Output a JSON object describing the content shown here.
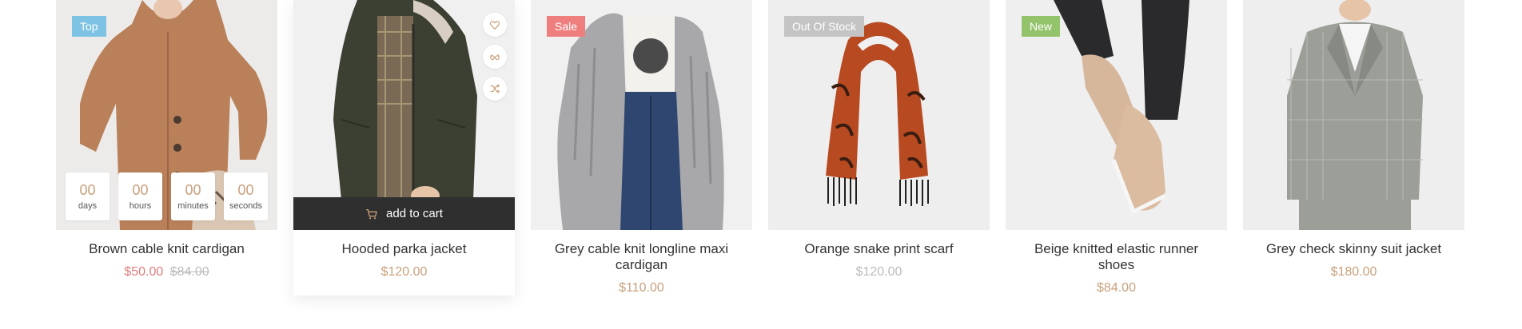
{
  "products": [
    {
      "name": "Brown cable knit cardigan",
      "badge": "Top",
      "badge_color": "#7ec3e4",
      "price": "$50.00",
      "old_price": "$84.00",
      "countdown": [
        {
          "value": "00",
          "label": "days"
        },
        {
          "value": "00",
          "label": "hours"
        },
        {
          "value": "00",
          "label": "minutes"
        },
        {
          "value": "00",
          "label": "seconds"
        }
      ]
    },
    {
      "name": "Hooded parka jacket",
      "price": "$120.00",
      "cart_label": "add to cart",
      "action_icons": [
        "heart-icon",
        "glasses-icon",
        "shuffle-icon"
      ]
    },
    {
      "name": "Grey cable knit longline maxi cardigan",
      "badge": "Sale",
      "badge_color": "#ef7f7f",
      "price": "$110.00"
    },
    {
      "name": "Orange snake print scarf",
      "badge": "Out Of Stock",
      "badge_color": "#c4c4c4",
      "price": "$120.00"
    },
    {
      "name": "Beige knitted elastic runner shoes",
      "badge": "New",
      "badge_color": "#93c36a",
      "price": "$84.00"
    },
    {
      "name": "Grey check skinny suit jacket",
      "price": "$180.00"
    }
  ],
  "colors": {
    "accent_price": "#c8a07c",
    "sale_price": "#e07c7c",
    "muted_price": "#bbbbbb",
    "cart_bar": "#2f2f2f"
  }
}
